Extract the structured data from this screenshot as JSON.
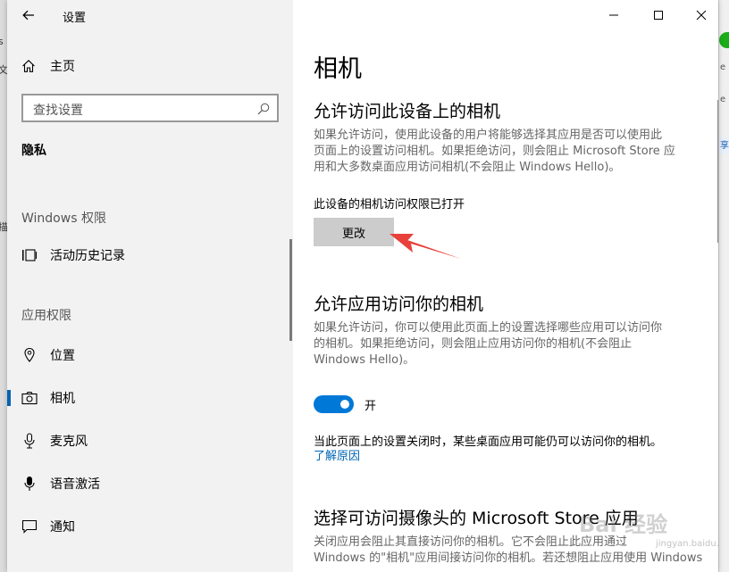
{
  "window": {
    "title": "设置",
    "icons": {
      "back": "back-arrow-icon",
      "minimize": "minimize-icon",
      "maximize": "maximize-icon",
      "close": "close-icon"
    }
  },
  "sidebar": {
    "home": {
      "label": "主页",
      "icon": "home-icon"
    },
    "search": {
      "placeholder": "查找设置",
      "icon": "search-icon"
    },
    "section": "隐私",
    "windows_group": "Windows 权限",
    "windows_items": [
      {
        "label": "活动历史记录",
        "icon": "activity-history-icon"
      }
    ],
    "app_group": "应用权限",
    "app_items": [
      {
        "label": "位置",
        "icon": "location-icon"
      },
      {
        "label": "相机",
        "icon": "camera-icon",
        "selected": true
      },
      {
        "label": "麦克风",
        "icon": "microphone-icon"
      },
      {
        "label": "语音激活",
        "icon": "voice-activation-icon"
      },
      {
        "label": "通知",
        "icon": "notification-icon"
      }
    ]
  },
  "content": {
    "title": "相机",
    "device_section": {
      "heading": "允许访问此设备上的相机",
      "lines": [
        "如果允许访问，使用此设备的用户将能够选择其应用是否可以使用此",
        "页面上的设置访问相机。如果拒绝访问，则会阻止 Microsoft Store 应",
        "用和大多数桌面应用访问相机(不会阻止 Windows Hello)。"
      ],
      "status": "此设备的相机访问权限已打开",
      "button": "更改"
    },
    "app_section": {
      "heading": "允许应用访问你的相机",
      "lines": [
        "如果允许访问，你可以使用此页面上的设置选择哪些应用可以访问你",
        "的相机。如果拒绝访问，则会阻止应用访问你的相机(不会阻止",
        "Windows Hello)。"
      ],
      "toggle_state": "开",
      "toggle_on": true,
      "note": "当此页面上的设置关闭时，某些桌面应用可能仍可以访问你的相机。",
      "link": "了解原因"
    },
    "store_section": {
      "heading": "选择可访问摄像头的 Microsoft Store 应用",
      "lines": [
        "关闭应用会阻止其直接访问你的相机。它不会阻止此应用通过",
        "Windows 的\"相机\"应用间接访问你的相机。若还想阻止应用使用 Windows"
      ]
    }
  },
  "background": {
    "left_fragments": [
      "s",
      "文",
      "描"
    ],
    "right_fragments": [
      "e",
      "e",
      "享"
    ]
  },
  "watermark": {
    "text": "Bai 经验",
    "sub": "jingyan.baidu.com"
  },
  "colors": {
    "accent": "#0078d7",
    "link": "#0066b4",
    "sidebar_bg": "#f2f2f2",
    "button_bg": "#cccccc",
    "annotation_arrow": "#e8413b"
  }
}
